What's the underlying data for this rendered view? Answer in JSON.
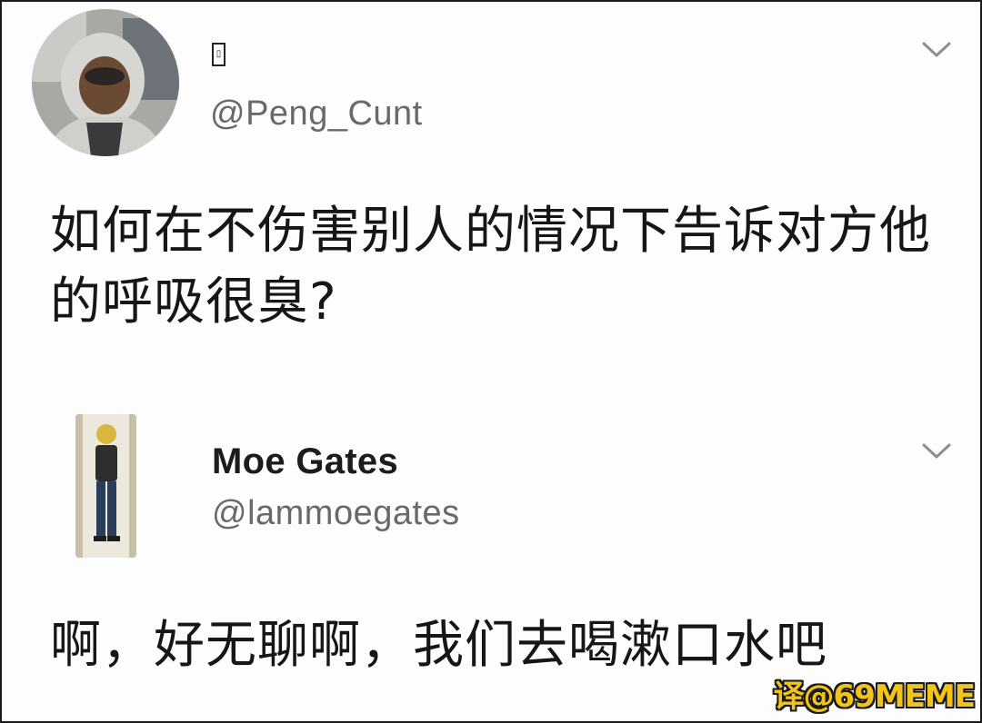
{
  "tweet": {
    "name_glyph": "▯",
    "handle": "@Peng_Cunt",
    "text": "如何在不伤害别人的情况下告诉对方他的呼吸很臭?"
  },
  "reply": {
    "display_name": "Moe Gates",
    "handle": "@lammoegates",
    "text": "啊，好无聊啊，我们去喝漱口水吧"
  },
  "watermark": "译@69MEME",
  "colors": {
    "text": "#161616",
    "handle": "#666a6e",
    "chevron": "#8a8f94",
    "watermark_fill": "#f2c31a"
  },
  "icons": {
    "avatar_1": "avatar-photo-hooded-man",
    "avatar_2": "avatar-photo-standing-man",
    "chevron": "chevron-down-icon"
  }
}
